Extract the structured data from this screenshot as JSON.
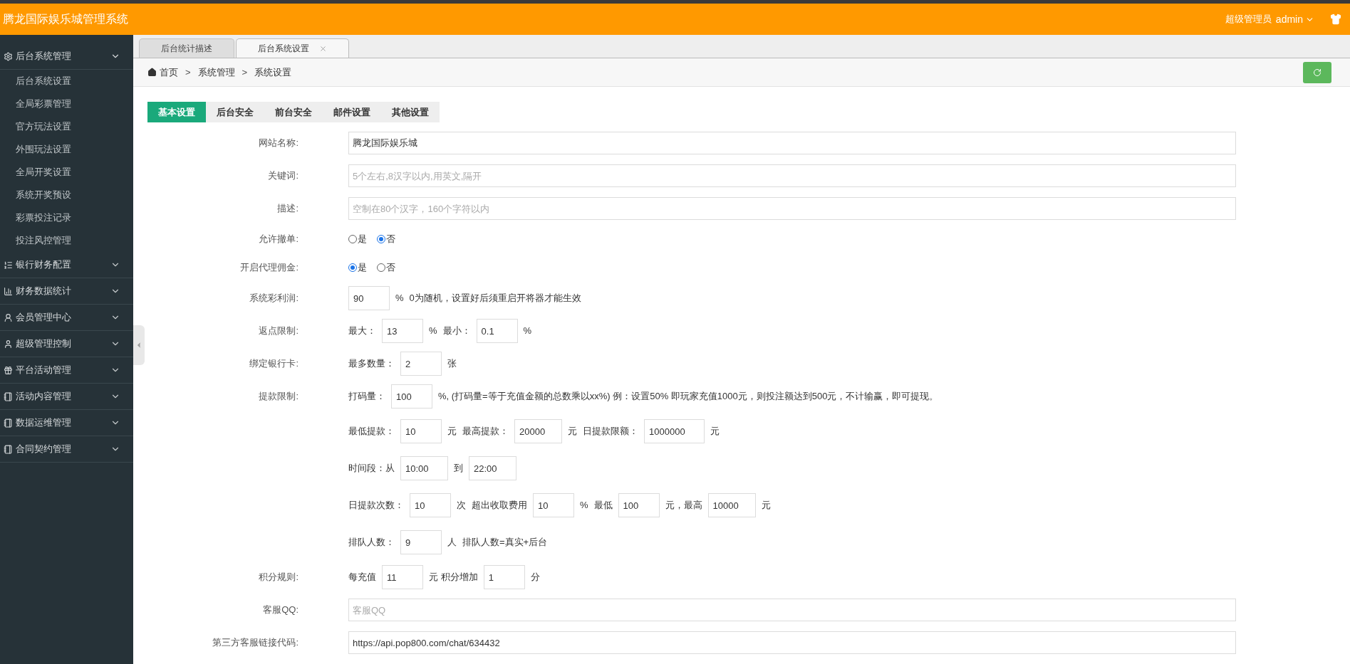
{
  "header": {
    "title": "腾龙国际娱乐城管理系统",
    "role": "超级管理员",
    "user": "admin"
  },
  "sidebar": [
    {
      "label": "后台系统管理",
      "expanded": true,
      "children": [
        {
          "label": "后台系统设置"
        },
        {
          "label": "全局彩票管理"
        },
        {
          "label": "官方玩法设置"
        },
        {
          "label": "外围玩法设置"
        },
        {
          "label": "全局开奖设置"
        },
        {
          "label": "系统开奖预设"
        },
        {
          "label": "彩票投注记录"
        },
        {
          "label": "投注风控管理"
        }
      ]
    },
    {
      "label": "银行财务配置",
      "expanded": false
    },
    {
      "label": "财务数据统计",
      "expanded": false
    },
    {
      "label": "会员管理中心",
      "expanded": false
    },
    {
      "label": "超级管理控制",
      "expanded": false
    },
    {
      "label": "平台活动管理",
      "expanded": false
    },
    {
      "label": "活动内容管理",
      "expanded": false
    },
    {
      "label": "数据运维管理",
      "expanded": false
    },
    {
      "label": "合同契约管理",
      "expanded": false
    }
  ],
  "page_tabs": [
    {
      "label": "后台统计描述",
      "selected": false,
      "closable": false
    },
    {
      "label": "后台系统设置",
      "selected": true,
      "closable": true
    }
  ],
  "breadcrumb": {
    "items": [
      "首页",
      "系统管理",
      "系统设置"
    ],
    "separator": ">"
  },
  "settings_tabs": [
    {
      "label": "基本设置",
      "selected": true
    },
    {
      "label": "后台安全",
      "selected": false
    },
    {
      "label": "前台安全",
      "selected": false
    },
    {
      "label": "邮件设置",
      "selected": false
    },
    {
      "label": "其他设置",
      "selected": false
    }
  ],
  "form": [
    {
      "kind": "text",
      "label": "网站名称:",
      "value": "腾龙国际娱乐城"
    },
    {
      "kind": "text",
      "label": "关键词:",
      "placeholder": "5个左右,8汉字以内,用英文,隔开"
    },
    {
      "kind": "text",
      "label": "描述:",
      "placeholder": "空制在80个汉字，160个字符以内"
    },
    {
      "kind": "radio",
      "label": "允许撤单:",
      "options": [
        {
          "label": "是",
          "selected": false
        },
        {
          "label": "否",
          "selected": true
        }
      ]
    },
    {
      "kind": "radio",
      "label": "开启代理佣金:",
      "options": [
        {
          "label": "是",
          "selected": true
        },
        {
          "label": "否",
          "selected": false
        }
      ]
    },
    {
      "kind": "inline",
      "label": "系统彩利润:",
      "lines": [
        [
          {
            "kind": "input",
            "value": "90"
          },
          {
            "kind": "text",
            "text": "%"
          },
          {
            "kind": "text",
            "text": "0为随机，设置好后须重启开将器才能生效"
          }
        ]
      ]
    },
    {
      "kind": "inline",
      "label": "返点限制:",
      "lines": [
        [
          {
            "kind": "text",
            "text": "最大："
          },
          {
            "kind": "input",
            "value": "13"
          },
          {
            "kind": "text",
            "text": "%"
          },
          {
            "kind": "text",
            "text": "最小："
          },
          {
            "kind": "input",
            "value": "0.1"
          },
          {
            "kind": "text",
            "text": "%"
          }
        ]
      ]
    },
    {
      "kind": "inline",
      "label": "绑定银行卡:",
      "lines": [
        [
          {
            "kind": "text",
            "text": "最多数量："
          },
          {
            "kind": "input",
            "value": "2"
          },
          {
            "kind": "text",
            "text": "张"
          }
        ]
      ]
    },
    {
      "kind": "inline",
      "label": "提款限制:",
      "lines": [
        [
          {
            "kind": "text",
            "text": "打码量："
          },
          {
            "kind": "input",
            "value": "100"
          },
          {
            "kind": "text",
            "text": "%, (打码量=等于充值金额的总数乘以xx%) 例：设置50% 即玩家充值1000元，则投注额达到500元，不计输赢，即可提现。"
          }
        ],
        [
          {
            "kind": "text",
            "text": "最低提款："
          },
          {
            "kind": "input",
            "value": "10"
          },
          {
            "kind": "text",
            "text": "元"
          },
          {
            "kind": "text",
            "text": "最高提款："
          },
          {
            "kind": "input",
            "value": "20000"
          },
          {
            "kind": "text",
            "text": "元"
          },
          {
            "kind": "text",
            "text": "日提款限额："
          },
          {
            "kind": "input",
            "value": "1000000"
          },
          {
            "kind": "text",
            "text": "元"
          }
        ],
        [
          {
            "kind": "text",
            "text": "时间段：从"
          },
          {
            "kind": "input",
            "value": "10:00"
          },
          {
            "kind": "text",
            "text": "到"
          },
          {
            "kind": "input",
            "value": "22:00"
          }
        ],
        [
          {
            "kind": "text",
            "text": "日提款次数："
          },
          {
            "kind": "input",
            "value": "10"
          },
          {
            "kind": "text",
            "text": "次"
          },
          {
            "kind": "text",
            "text": "超出收取费用"
          },
          {
            "kind": "input",
            "value": "10"
          },
          {
            "kind": "text",
            "text": "%"
          },
          {
            "kind": "text",
            "text": "最低"
          },
          {
            "kind": "input",
            "value": "100"
          },
          {
            "kind": "text",
            "text": "元，最高"
          },
          {
            "kind": "input",
            "value": "10000"
          },
          {
            "kind": "text",
            "text": "元"
          }
        ],
        [
          {
            "kind": "text",
            "text": "排队人数："
          },
          {
            "kind": "input",
            "value": "9"
          },
          {
            "kind": "text",
            "text": "人"
          },
          {
            "kind": "text",
            "text": "排队人数=真实+后台"
          }
        ]
      ]
    },
    {
      "kind": "inline",
      "label": "积分规则:",
      "lines": [
        [
          {
            "kind": "text",
            "text": "每充值"
          },
          {
            "kind": "input",
            "value": "11"
          },
          {
            "kind": "text",
            "text": "元 积分增加"
          },
          {
            "kind": "input",
            "value": "1"
          },
          {
            "kind": "text",
            "text": "分"
          }
        ]
      ]
    },
    {
      "kind": "text",
      "label": "客服QQ:",
      "placeholder": "客服QQ"
    },
    {
      "kind": "text",
      "label": "第三方客服链接代码:",
      "value": "https://api.pop800.com/chat/634432"
    }
  ]
}
